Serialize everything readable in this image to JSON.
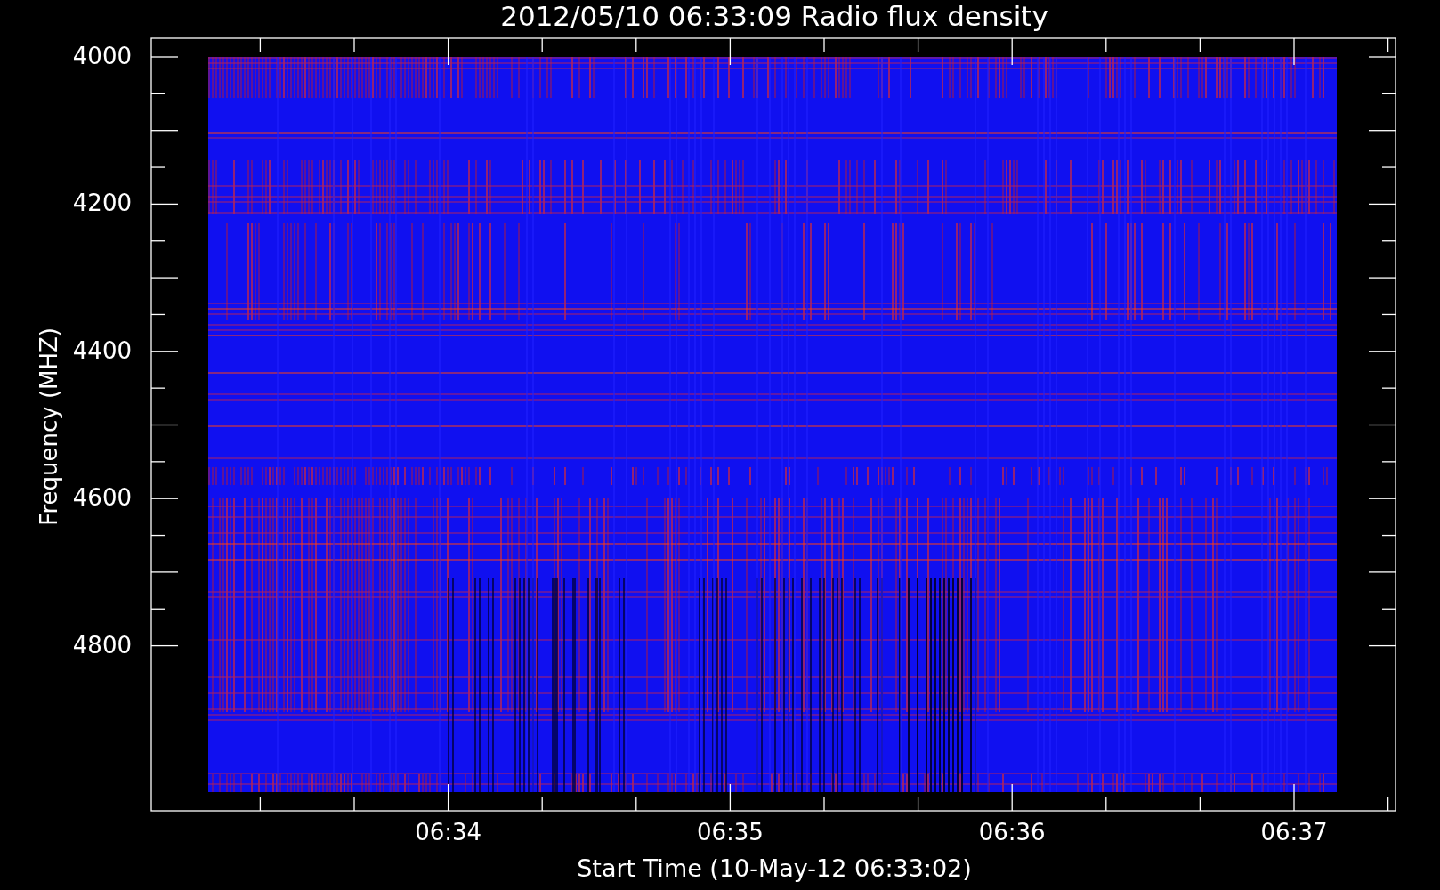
{
  "plot": {
    "title": "2012/05/10 06:33:09 Radio flux density",
    "xlabel": "Start Time (10-May-12 06:33:02)",
    "ylabel": "Frequency (MHZ)",
    "y_tick_labels": [
      "4000",
      "4200",
      "4400",
      "4600",
      "4800"
    ],
    "x_tick_labels": [
      "06:34",
      "06:35",
      "06:36",
      "06:37"
    ]
  }
}
